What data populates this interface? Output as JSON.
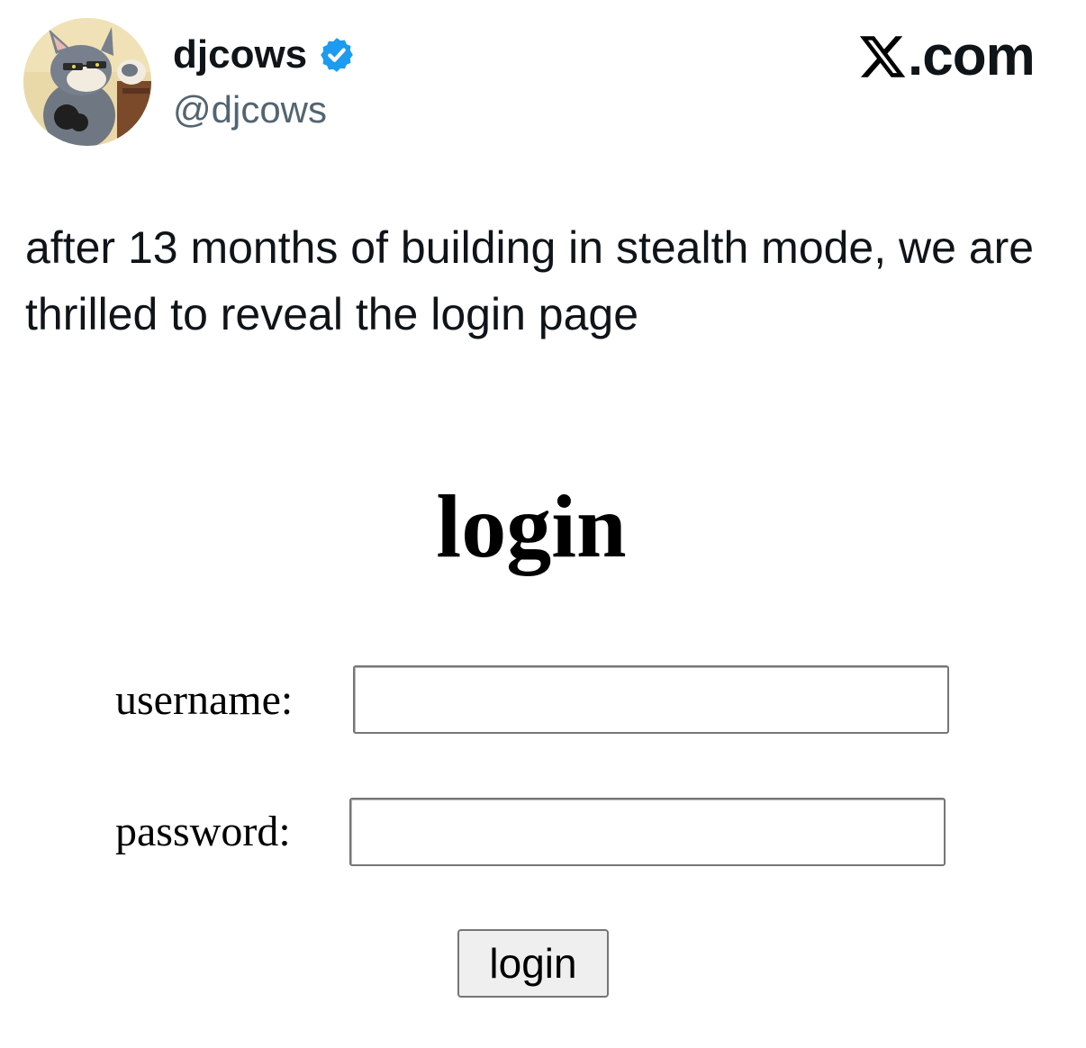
{
  "post": {
    "author": {
      "display_name": "djcows",
      "handle": "@djcows",
      "verified": true,
      "avatar_icon": "cartoon-cat-avatar-icon"
    },
    "brand": {
      "text": ".com",
      "icon": "x-logo-icon"
    },
    "text": "after 13 months of building in stealth mode, we are thrilled to reveal the login page"
  },
  "login_form": {
    "title": "login",
    "username_label": "username:",
    "username_value": "",
    "password_label": "password:",
    "password_value": "",
    "submit_label": "login"
  },
  "colors": {
    "text_primary": "#0f1419",
    "text_secondary": "#536471",
    "verified_blue": "#1d9bf0",
    "button_bg": "#efefef",
    "input_border": "#767676"
  }
}
